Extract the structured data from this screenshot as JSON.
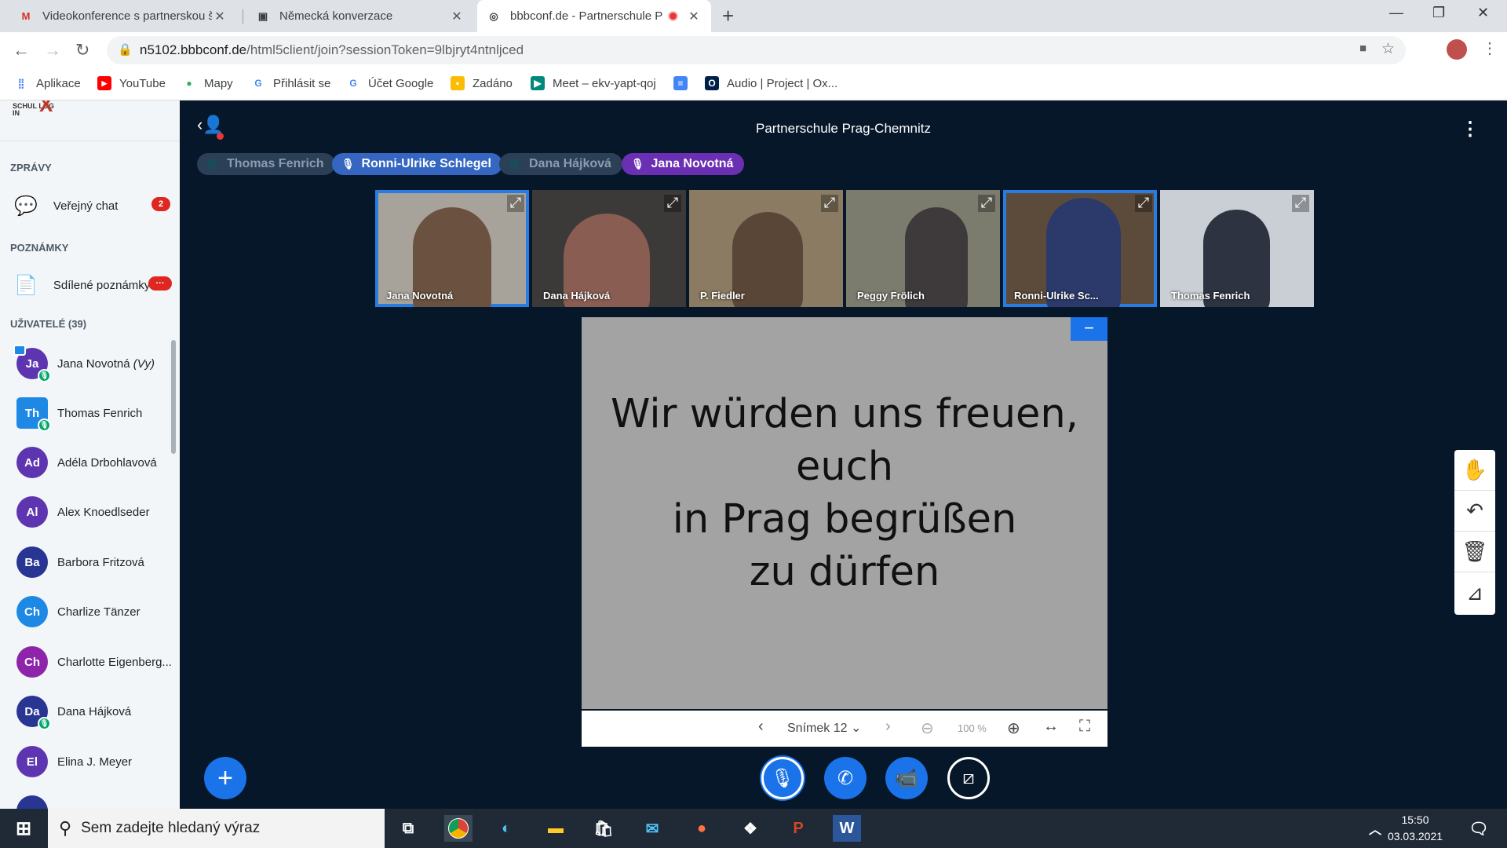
{
  "browser": {
    "tabs": [
      {
        "title": "Videokonference s partnerskou š",
        "favicon": "M"
      },
      {
        "title": "Německá konverzace",
        "favicon": "▣"
      },
      {
        "title": "bbbconf.de - Partnerschule P",
        "favicon": "◎"
      }
    ],
    "url_host": "n5102.bbbconf.de",
    "url_path": "/html5client/join?sessionToken=9lbjryt4ntnljced",
    "bookmarks": [
      "Aplikace",
      "YouTube",
      "Mapy",
      "Přihlásit se",
      "Účet Google",
      "Zadáno",
      "Meet – ekv-yapt-qoj",
      "",
      "Audio | Project | Ox..."
    ]
  },
  "sidebar": {
    "logo_text": "SCHUL LOG IN",
    "messages_heading": "ZPRÁVY",
    "public_chat": {
      "label": "Veřejný chat",
      "badge": "2"
    },
    "notes_heading": "POZNÁMKY",
    "shared_notes": {
      "label": "Sdílené poznámky",
      "badge": "···"
    },
    "users_heading": "UŽIVATELÉ (39)",
    "users": [
      {
        "initials": "Ja",
        "name": "Jana Novotná",
        "suffix": "(Vy)",
        "color": "#5e35b1",
        "mic": true
      },
      {
        "initials": "Th",
        "name": "Thomas Fenrich",
        "suffix": "",
        "color": "#1e88e5",
        "mic": true
      },
      {
        "initials": "Ad",
        "name": "Adéla Drbohlavová",
        "suffix": "",
        "color": "#5e35b1",
        "mic": false
      },
      {
        "initials": "Al",
        "name": "Alex Knoedlseder",
        "suffix": "",
        "color": "#5e35b1",
        "mic": false
      },
      {
        "initials": "Ba",
        "name": "Barbora Fritzová",
        "suffix": "",
        "color": "#283593",
        "mic": false
      },
      {
        "initials": "Ch",
        "name": "Charlize Tänzer",
        "suffix": "",
        "color": "#1e88e5",
        "mic": false
      },
      {
        "initials": "Ch",
        "name": "Charlotte Eigenberg...",
        "suffix": "",
        "color": "#8e24aa",
        "mic": false
      },
      {
        "initials": "Da",
        "name": "Dana Hájková",
        "suffix": "",
        "color": "#283593",
        "mic": true
      },
      {
        "initials": "El",
        "name": "Elina J. Meyer",
        "suffix": "",
        "color": "#5e35b1",
        "mic": false
      }
    ]
  },
  "meeting": {
    "title": "Partnerschule Prag-Chemnitz",
    "talkers": [
      {
        "name": "Thomas Fenrich",
        "active": false
      },
      {
        "name": "Ronni-Ulrike Schlegel",
        "active": true
      },
      {
        "name": "Dana Hájková",
        "active": false
      },
      {
        "name": "Jana Novotná",
        "active": true
      }
    ],
    "videos": [
      {
        "name": "Jana Novotná",
        "highlight": true,
        "bg": "#a8a39a"
      },
      {
        "name": "Dana Hájková",
        "highlight": false,
        "bg": "#3c3a38"
      },
      {
        "name": "P. Fiedler",
        "highlight": false,
        "bg": "#8a7b62"
      },
      {
        "name": "Peggy Frölich",
        "highlight": false,
        "bg": "#7b7c6e"
      },
      {
        "name": "Ronni-Ulrike Sc...",
        "highlight": true,
        "bg": "#5c4a3a"
      },
      {
        "name": "Thomas Fenrich",
        "highlight": false,
        "bg": "#c9cfd4"
      }
    ],
    "slide_lines": [
      "Wir würden uns freuen,",
      "euch",
      "in Prag begrüßen",
      "zu dürfen"
    ],
    "slide_label": "Snímek 12",
    "zoom": "100 %"
  },
  "taskbar": {
    "search_placeholder": "Sem zadejte hledaný výraz",
    "time": "15:50",
    "date": "03.03.2021"
  }
}
